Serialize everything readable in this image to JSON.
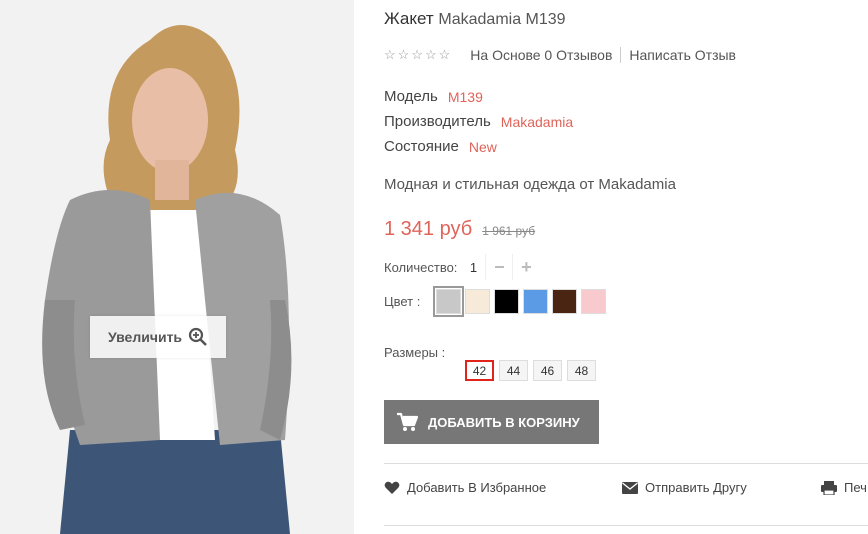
{
  "product": {
    "name": "Жакет",
    "brand_model": "Makadamia M139",
    "image_zoom_label": "Увеличить",
    "rating": {
      "stars_display": "☆☆☆☆☆",
      "reviews_text": "На Основе 0 Отзывов",
      "write_review": "Написать Отзыв"
    },
    "specs": [
      {
        "label": "Модель",
        "value": "M139"
      },
      {
        "label": "Производитель",
        "value": "Makadamia"
      },
      {
        "label": "Состояние",
        "value": "New"
      }
    ],
    "description": "Модная и стильная одежда от Makadamia",
    "price": {
      "current": "1 341 руб",
      "old": "1 961 руб"
    },
    "quantity": {
      "label": "Количество:",
      "value": "1",
      "minus": "−",
      "plus": "+"
    },
    "colors": {
      "label": "Цвет :",
      "swatches": [
        "#c8c8c8",
        "#f7ead9",
        "#000000",
        "#5b9be6",
        "#4a2511",
        "#f8c9cd"
      ],
      "selected_index": 0
    },
    "sizes": {
      "label": "Размеры :",
      "options": [
        "42",
        "44",
        "46",
        "48"
      ],
      "selected": "42"
    },
    "add_to_cart": "ДОБАВИТЬ В КОРЗИНУ",
    "actions": {
      "wishlist": "Добавить В Избранное",
      "send_friend": "Отправить Другу",
      "print": "Печ"
    }
  },
  "colors": {
    "accent": "#e0645a",
    "button_bg": "#777777",
    "size_selected_border": "#e0241b"
  }
}
